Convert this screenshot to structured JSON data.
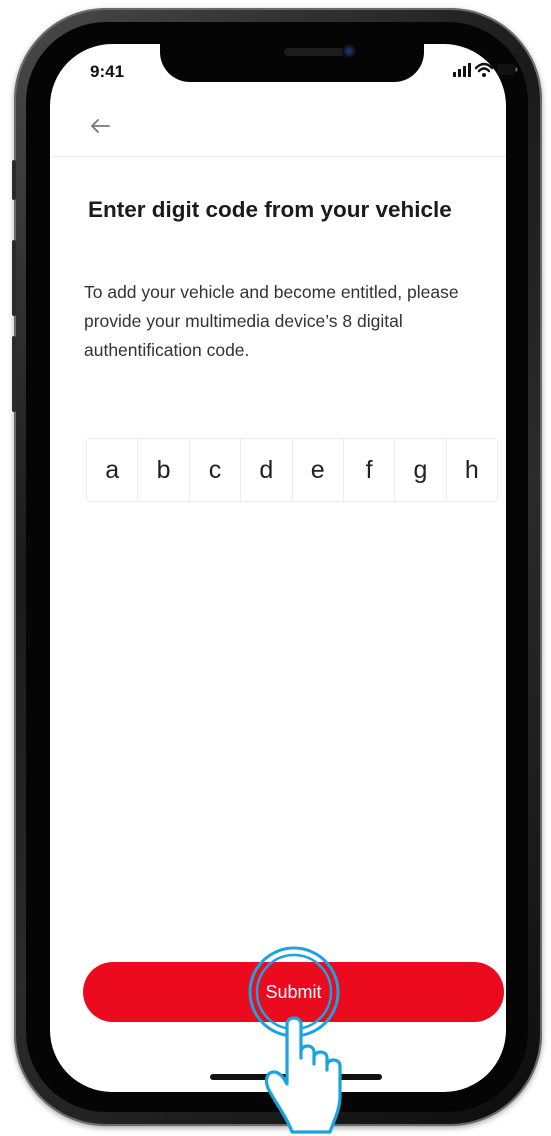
{
  "status_bar": {
    "time": "9:41",
    "icons": [
      "signal-icon",
      "wifi-icon",
      "battery-icon"
    ]
  },
  "header": {
    "back_icon": "arrow-left-icon"
  },
  "main": {
    "title": "Enter digit code from your vehicle",
    "description": "To add your vehicle and become entitled, please provide your multimedia device’s 8 digital authentification code.",
    "code_digits": [
      "a",
      "b",
      "c",
      "d",
      "e",
      "f",
      "g",
      "h"
    ]
  },
  "footer": {
    "submit_label": "Submit"
  },
  "colors": {
    "accent": "#eb0a1e",
    "tap_highlight": "#1aa3e0",
    "text_primary": "#1b1b1b"
  }
}
